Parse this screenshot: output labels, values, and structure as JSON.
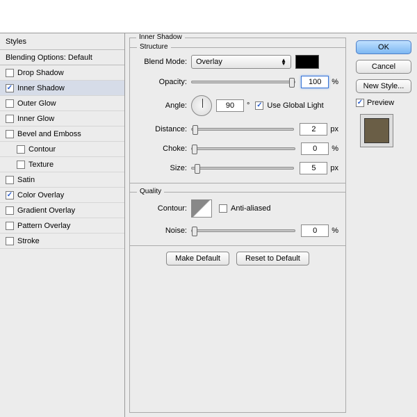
{
  "styles_header": "Styles",
  "blending_header": "Blending Options: Default",
  "styles": [
    {
      "label": "Drop Shadow",
      "checked": false
    },
    {
      "label": "Inner Shadow",
      "checked": true,
      "selected": true
    },
    {
      "label": "Outer Glow",
      "checked": false
    },
    {
      "label": "Inner Glow",
      "checked": false
    },
    {
      "label": "Bevel and Emboss",
      "checked": false
    },
    {
      "label": "Contour",
      "checked": false,
      "indent": true
    },
    {
      "label": "Texture",
      "checked": false,
      "indent": true
    },
    {
      "label": "Satin",
      "checked": false
    },
    {
      "label": "Color Overlay",
      "checked": true
    },
    {
      "label": "Gradient Overlay",
      "checked": false
    },
    {
      "label": "Pattern Overlay",
      "checked": false
    },
    {
      "label": "Stroke",
      "checked": false
    }
  ],
  "panel_title": "Inner Shadow",
  "structure": {
    "title": "Structure",
    "blend_mode_label": "Blend Mode:",
    "blend_mode_value": "Overlay",
    "color": "#000000",
    "opacity_label": "Opacity:",
    "opacity_value": "100",
    "opacity_unit": "%",
    "angle_label": "Angle:",
    "angle_value": "90",
    "angle_unit": "°",
    "global_light_label": "Use Global Light",
    "global_light_checked": true,
    "distance_label": "Distance:",
    "distance_value": "2",
    "distance_unit": "px",
    "choke_label": "Choke:",
    "choke_value": "0",
    "choke_unit": "%",
    "size_label": "Size:",
    "size_value": "5",
    "size_unit": "px"
  },
  "quality": {
    "title": "Quality",
    "contour_label": "Contour:",
    "antialiased_label": "Anti-aliased",
    "antialiased_checked": false,
    "noise_label": "Noise:",
    "noise_value": "0",
    "noise_unit": "%"
  },
  "buttons": {
    "make_default": "Make Default",
    "reset_default": "Reset to Default"
  },
  "right": {
    "ok": "OK",
    "cancel": "Cancel",
    "new_style": "New Style...",
    "preview": "Preview",
    "preview_checked": true
  }
}
